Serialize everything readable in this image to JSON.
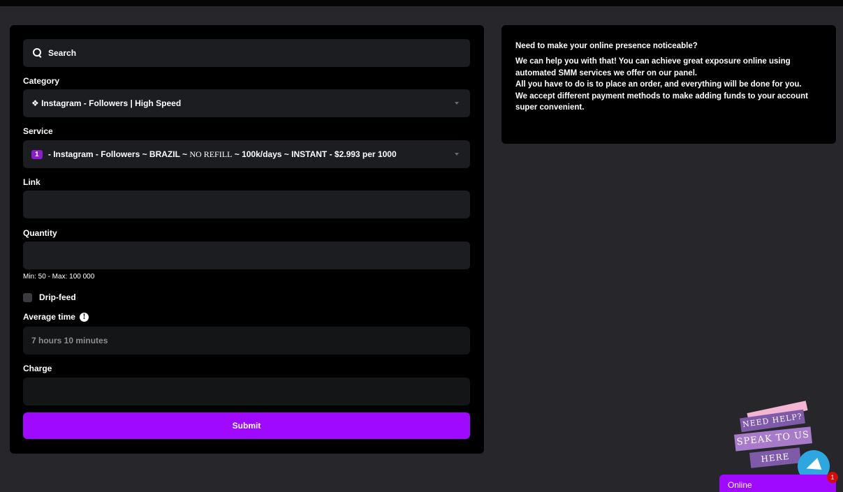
{
  "order_form": {
    "search": {
      "placeholder": "Search"
    },
    "category": {
      "label": "Category",
      "selected": "❖ Instagram - Followers | High Speed"
    },
    "service": {
      "label": "Service",
      "badge": "1",
      "selected_prefix": " - Instagram - Followers ~ BRAZIL ~ ",
      "selected_norefill": "NO REFILL",
      "selected_suffix": " ~ 100k/days ~ INSTANT - $2.993 per 1000"
    },
    "link": {
      "label": "Link",
      "value": ""
    },
    "quantity": {
      "label": "Quantity",
      "value": "",
      "hint": "Min: 50 - Max: 100 000"
    },
    "drip_feed": {
      "label": "Drip-feed",
      "checked": false
    },
    "average_time": {
      "label": "Average time",
      "value": "7 hours 10 minutes",
      "info_glyph": "!"
    },
    "charge": {
      "label": "Charge",
      "value": ""
    },
    "submit_label": "Submit"
  },
  "info_panel": {
    "heading": "Need to make your online presence noticeable?",
    "lines": [
      "We can help you with that! You can achieve great exposure online using automated SMM services we offer on our panel.",
      "All you have to do is to place an order, and everything will be done for you.",
      "We accept different payment methods to make adding funds to your account super convenient."
    ]
  },
  "help_widget": {
    "line1": "NEED HELP?",
    "line2": "SPEAK TO US",
    "line3": "HERE",
    "status": "Online",
    "notification_count": "1",
    "icon": "telegram-icon"
  },
  "colors": {
    "accent": "#a009ff",
    "badge": "#8a1ec9",
    "page_bg": "#27262b",
    "panel_bg": "#000000",
    "field_bg": "#1c1d21"
  }
}
